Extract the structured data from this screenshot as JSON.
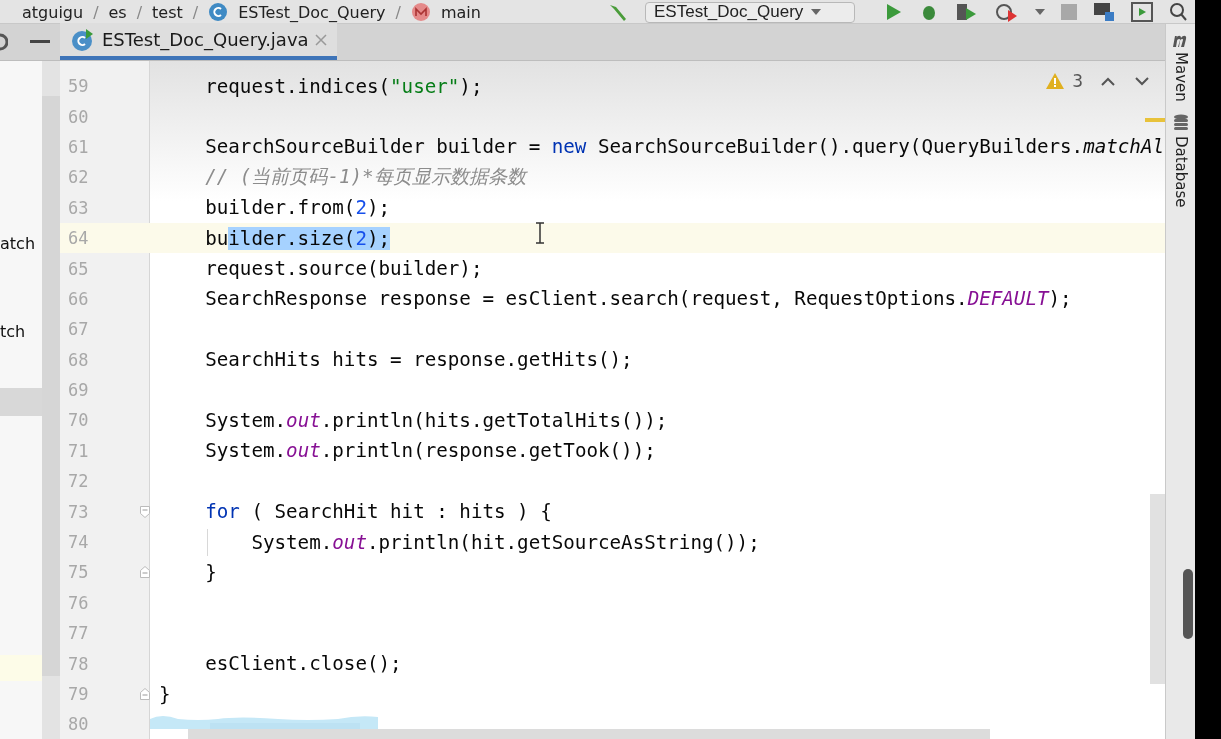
{
  "breadcrumb": {
    "separator": "/",
    "items": [
      {
        "label": "atguigu",
        "kind": "folder"
      },
      {
        "label": "es",
        "kind": "folder"
      },
      {
        "label": "test",
        "kind": "folder"
      },
      {
        "label": "ESTest_Doc_Query",
        "kind": "class"
      },
      {
        "label": "main",
        "kind": "method"
      }
    ]
  },
  "run_config": {
    "label": "ESTest_Doc_Query"
  },
  "left_panel": {
    "items": [
      {
        "label": "atch"
      },
      {
        "label": "tch"
      }
    ]
  },
  "tab": {
    "label": "ESTest_Doc_Query.java",
    "selected": true
  },
  "inspections": {
    "warnings": "3"
  },
  "lines": [
    {
      "number": "59",
      "current": false,
      "tokens": [
        {
          "t": "    request.indices(",
          "kind": "plain"
        },
        {
          "t": "\"user\"",
          "kind": "string"
        },
        {
          "t": ");",
          "kind": "plain"
        }
      ]
    },
    {
      "number": "60",
      "current": false
    },
    {
      "number": "61",
      "current": false,
      "tokens": [
        {
          "t": "    SearchSourceBuilder builder = ",
          "kind": "plain"
        },
        {
          "t": "new",
          "kind": "keyword"
        },
        {
          "t": " SearchSourceBuilder().query(QueryBuilders.",
          "kind": "plain"
        },
        {
          "t": "matchAl",
          "kind": "italic"
        }
      ]
    },
    {
      "number": "62",
      "current": false,
      "tokens": [
        {
          "t": "    // (当前页码-1)*每页显示数据条数",
          "kind": "comment"
        }
      ]
    },
    {
      "number": "63",
      "current": false,
      "tokens": [
        {
          "t": "    builder.from(",
          "kind": "plain"
        },
        {
          "t": "2",
          "kind": "number"
        },
        {
          "t": ");",
          "kind": "plain"
        }
      ]
    },
    {
      "number": "64",
      "current": true,
      "tokens": [
        {
          "t": "    bu",
          "kind": "plain"
        },
        {
          "t": "ilder.size(",
          "kind": "selected"
        },
        {
          "t": "2",
          "kind": "selected-number"
        },
        {
          "t": ");",
          "kind": "selected"
        }
      ]
    },
    {
      "number": "65",
      "current": false,
      "tokens": [
        {
          "t": "    request.source(builder);",
          "kind": "plain"
        }
      ]
    },
    {
      "number": "66",
      "current": false,
      "tokens": [
        {
          "t": "    SearchResponse response = esClient.search(request, RequestOptions.",
          "kind": "plain"
        },
        {
          "t": "DEFAULT",
          "kind": "static"
        },
        {
          "t": ");",
          "kind": "plain"
        }
      ]
    },
    {
      "number": "67",
      "current": false
    },
    {
      "number": "68",
      "current": false,
      "tokens": [
        {
          "t": "    SearchHits hits = response.getHits();",
          "kind": "plain"
        }
      ]
    },
    {
      "number": "69",
      "current": false
    },
    {
      "number": "70",
      "current": false,
      "tokens": [
        {
          "t": "    System.",
          "kind": "plain"
        },
        {
          "t": "out",
          "kind": "static"
        },
        {
          "t": ".println(hits.getTotalHits());",
          "kind": "plain"
        }
      ]
    },
    {
      "number": "71",
      "current": false,
      "tokens": [
        {
          "t": "    System.",
          "kind": "plain"
        },
        {
          "t": "out",
          "kind": "static"
        },
        {
          "t": ".println(response.getTook());",
          "kind": "plain"
        }
      ]
    },
    {
      "number": "72",
      "current": false
    },
    {
      "number": "73",
      "current": false,
      "kind": "fold-start",
      "tokens": [
        {
          "t": "    for",
          "kind": "keyword"
        },
        {
          "t": " ( SearchHit hit : hits ) {",
          "kind": "plain"
        }
      ]
    },
    {
      "number": "74",
      "current": false,
      "tokens": [
        {
          "t": "        System.",
          "kind": "plain"
        },
        {
          "t": "out",
          "kind": "static"
        },
        {
          "t": ".println(hit.getSourceAsString());",
          "kind": "plain"
        }
      ]
    },
    {
      "number": "75",
      "current": false,
      "kind": "fold-end",
      "tokens": [
        {
          "t": "    }",
          "kind": "plain"
        }
      ]
    },
    {
      "number": "76",
      "current": false
    },
    {
      "number": "77",
      "current": false
    },
    {
      "number": "78",
      "current": false,
      "tokens": [
        {
          "t": "    esClient.close();",
          "kind": "plain"
        }
      ]
    },
    {
      "number": "79",
      "current": false,
      "kind": "fold-end",
      "tokens": [
        {
          "t": "}",
          "kind": "plain"
        }
      ]
    },
    {
      "number": "80",
      "current": false
    }
  ],
  "side_tools": [
    {
      "label": "Maven",
      "kind": "maven"
    },
    {
      "label": "Database",
      "kind": "database"
    }
  ]
}
